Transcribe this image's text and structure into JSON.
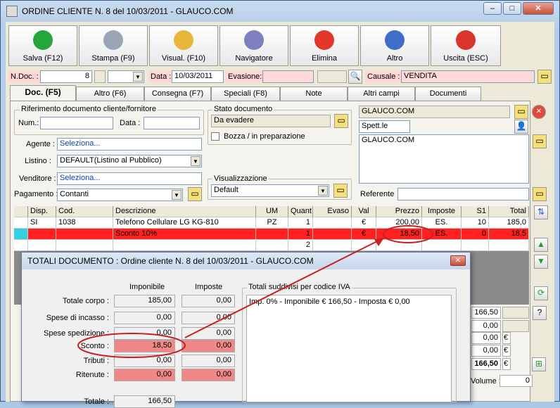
{
  "window": {
    "title": "ORDINE CLIENTE N. 8  del 10/03/2011 - GLAUCO.COM",
    "minimize": "–",
    "restore": "□",
    "close": "✕"
  },
  "toolbar": [
    {
      "label": "Salva (F12)",
      "icon": "check-icon",
      "color": "#23a63a"
    },
    {
      "label": "Stampa (F9)",
      "icon": "printer-icon",
      "color": "#9aa5b4"
    },
    {
      "label": "Visual. (F10)",
      "icon": "magic-wand-icon",
      "color": "#e6b73a"
    },
    {
      "label": "Navigatore",
      "icon": "compass-icon",
      "color": "#7d7fbf"
    },
    {
      "label": "Elimina",
      "icon": "delete-icon",
      "color": "#e2372a"
    },
    {
      "label": "Altro",
      "icon": "search-book-icon",
      "color": "#3e6ec8"
    },
    {
      "label": "Uscita (ESC)",
      "icon": "power-icon",
      "color": "#d8362c"
    }
  ],
  "header": {
    "ndoc_label": "N.Doc. :",
    "ndoc_value": "8",
    "data_label": "Data :",
    "data_value": "10/03/2011",
    "evasione_label": "Evasione:",
    "evasione_value": "",
    "causale_label": "Causale :",
    "causale_value": "VENDITA"
  },
  "tabs": [
    "Doc. (F5)",
    "Altro (F6)",
    "Consegna (F7)",
    "Speciali (F8)",
    "Note",
    "Altri campi",
    "Documenti"
  ],
  "rif": {
    "title": "Riferimento documento cliente/fornitore",
    "num_label": "Num.:",
    "num_value": "",
    "data_label": "Data :",
    "data_value": ""
  },
  "stato": {
    "title": "Stato documento",
    "value": "Da evadere",
    "bozza_label": "Bozza / in preparazione"
  },
  "cliente": {
    "name": "GLAUCO.COM",
    "title": "Spett.le",
    "address": "GLAUCO.COM",
    "referente_label": "Referente",
    "referente_value": ""
  },
  "form": {
    "agente_label": "Agente :",
    "agente_value": "Seleziona...",
    "listino_label": "Listino :",
    "listino_value": "DEFAULT(Listino al Pubblico)",
    "venditore_label": "Venditore :",
    "venditore_value": "Seleziona...",
    "pagamento_label": "Pagamento :",
    "pagamento_value": "Contanti"
  },
  "visualizzazione": {
    "title": "Visualizzazione",
    "value": "Default"
  },
  "table": {
    "headers": [
      "",
      "Disp.",
      "Cod.",
      "Descrizione",
      "UM",
      "Quant.",
      "Evaso",
      "Val",
      "Prezzo",
      "Imposte",
      "S1",
      "Total"
    ],
    "rows": [
      [
        "",
        "SI",
        "1038",
        "Telefono Cellulare LG KG-810",
        "PZ",
        "1",
        "",
        "€",
        "200,00",
        "ES.",
        "10",
        "185,0"
      ],
      [
        "",
        "",
        "",
        "Sconto 10%",
        "",
        "1",
        "",
        "€",
        "18,50",
        "ES.",
        "0",
        "18,5"
      ],
      [
        "",
        "",
        "",
        "",
        "",
        "2",
        "",
        "",
        "",
        "",
        "",
        ""
      ]
    ]
  },
  "right_totals": {
    "v1": "166,50",
    "q": "?",
    "v2": "0,00",
    "v3": "0,00",
    "v4": "0,00",
    "cur": "€",
    "total": "166,50",
    "volume_label": "Volume :",
    "volume_value": "0"
  },
  "dialog": {
    "title": "TOTALI DOCUMENTO : Ordine cliente N. 8 del 10/03/2011 - GLAUCO.COM",
    "col_imponibile": "Imponibile",
    "col_imposte": "Imposte",
    "rows": [
      {
        "label": "Totale corpo :",
        "imponibile": "185,00",
        "imposte": "0,00",
        "highlight": false
      },
      {
        "label": "Spese di incasso :",
        "imponibile": "0,00",
        "imposte": "0,00",
        "highlight": false
      },
      {
        "label": "Spese spedizione :",
        "imponibile": "0,00",
        "imposte": "0,00",
        "highlight": false
      },
      {
        "label": "Sconto :",
        "imponibile": "18,50",
        "imposte": "0,00",
        "highlight": true
      },
      {
        "label": "Tributi :",
        "imponibile": "0,00",
        "imposte": "0,00",
        "highlight": false
      },
      {
        "label": "Ritenute :",
        "imponibile": "0,00",
        "imposte": "0,00",
        "highlight": true
      },
      {
        "label": "Totale :",
        "imponibile": "166,50",
        "imposte": "",
        "highlight": false
      }
    ],
    "iva_title": "Totali suddivisi per codice IVA",
    "iva_line": "Imp. 0% - Imponibile € 166,50 - Imposta € 0,00"
  }
}
